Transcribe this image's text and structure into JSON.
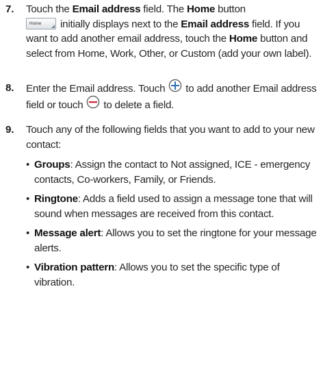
{
  "step7": {
    "number": "7.",
    "t1": "Touch the ",
    "b1": "Email address",
    "t2": " field. The ",
    "b2": "Home",
    "t3": " button",
    "button_label": "Home",
    "t4": "initially displays next to the ",
    "b3": "Email address",
    "t5": " field. If you want to add another email address, touch the ",
    "b4": "Home",
    "t6": " button and select from Home, Work, Other, or Custom (add your own label)."
  },
  "step8": {
    "number": "8.",
    "t1": "Enter the Email address. Touch ",
    "add_icon": "plus-circle-icon",
    "t2": " to add another Email address field or touch ",
    "delete_icon": "minus-circle-icon",
    "t3": " to delete a field."
  },
  "step9": {
    "number": "9.",
    "intro": "Touch any of the following fields that you want to add to your new contact:",
    "items": [
      {
        "term": "Groups",
        "desc": ": Assign the contact to Not assigned, ICE - emergency contacts, Co-workers, Family, or Friends."
      },
      {
        "term": "Ringtone",
        "desc": ": Adds a field used to assign a message tone that will sound when messages are received from this contact."
      },
      {
        "term": "Message alert",
        "desc": ": Allows you to set the ringtone for your message alerts."
      },
      {
        "term": "Vibration pattern",
        "desc": ": Allows you to set the specific type of vibration."
      }
    ]
  },
  "colors": {
    "plus": "#2f6fb3",
    "minus": "#d3223a",
    "text": "#262626"
  }
}
